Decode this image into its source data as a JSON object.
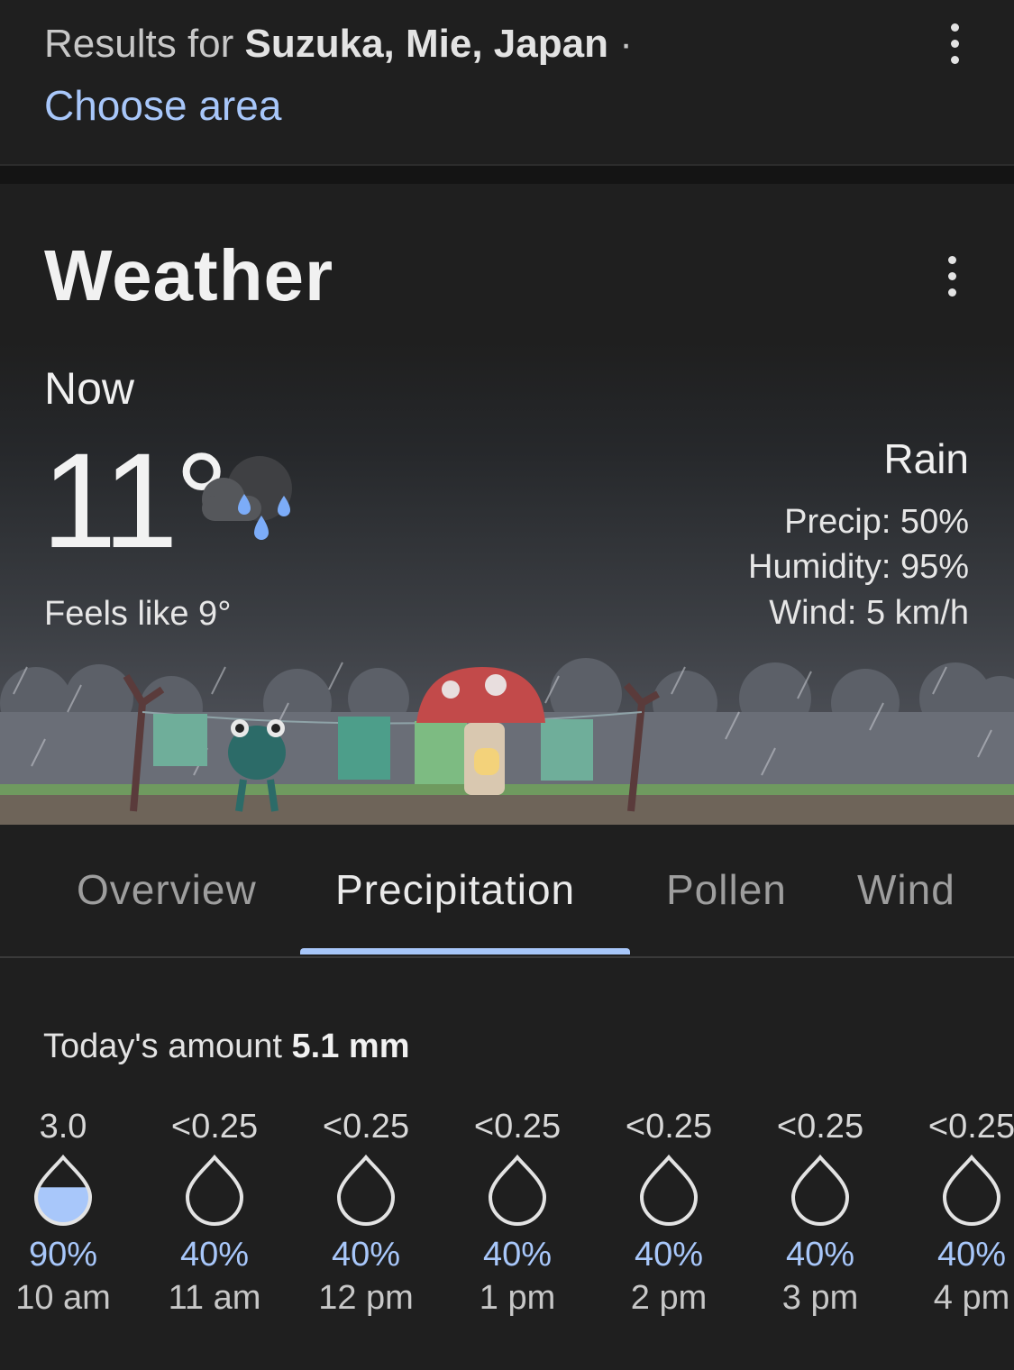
{
  "search": {
    "results_prefix": "Results for ",
    "location": "Suzuka, Mie, Japan",
    "separator": " ·",
    "choose_area": "Choose area"
  },
  "weather": {
    "title": "Weather",
    "now_label": "Now",
    "temperature": "11°",
    "condition_icon": "rain-cloud-icon",
    "feels_like": "Feels like 9°",
    "condition": "Rain",
    "precip": "Precip: 50%",
    "humidity": "Humidity: 95%",
    "wind": "Wind: 5 km/h"
  },
  "tabs": [
    {
      "label": "Overview",
      "active": false
    },
    {
      "label": "Precipitation",
      "active": true
    },
    {
      "label": "Pollen",
      "active": false
    },
    {
      "label": "Wind",
      "active": false
    }
  ],
  "precipitation": {
    "amount_prefix": "Today's amount ",
    "amount_value": "5.1 mm",
    "hours": [
      {
        "amount": "3.0",
        "chance": "90%",
        "time": "10 am",
        "fill": 0.55
      },
      {
        "amount": "<0.25",
        "chance": "40%",
        "time": "11 am",
        "fill": 0
      },
      {
        "amount": "<0.25",
        "chance": "40%",
        "time": "12 pm",
        "fill": 0
      },
      {
        "amount": "<0.25",
        "chance": "40%",
        "time": "1 pm",
        "fill": 0
      },
      {
        "amount": "<0.25",
        "chance": "40%",
        "time": "2 pm",
        "fill": 0
      },
      {
        "amount": "<0.25",
        "chance": "40%",
        "time": "3 pm",
        "fill": 0
      },
      {
        "amount": "<0.25",
        "chance": "40%",
        "time": "4 pm",
        "fill": 0
      }
    ]
  },
  "colors": {
    "accent": "#a8c7fa",
    "background": "#1f1f1f"
  }
}
